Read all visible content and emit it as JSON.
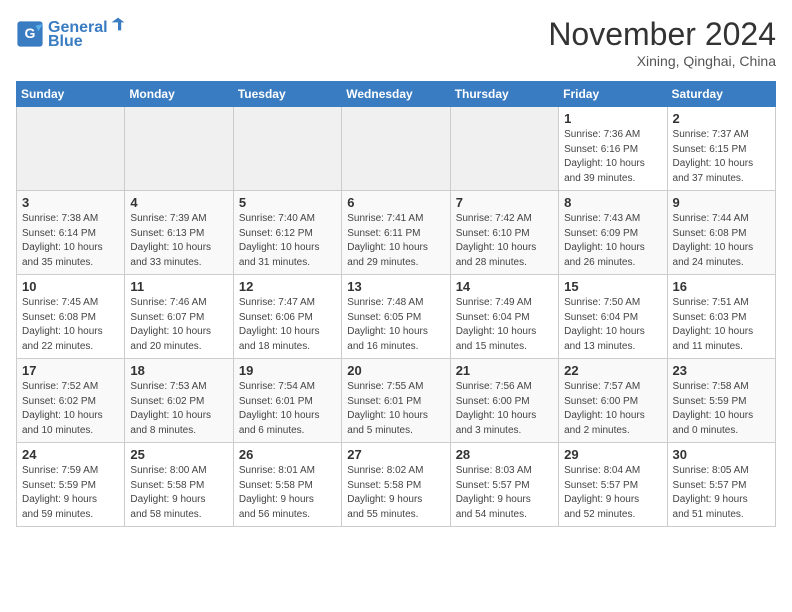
{
  "header": {
    "logo_line1": "General",
    "logo_line2": "Blue",
    "month": "November 2024",
    "location": "Xining, Qinghai, China"
  },
  "weekdays": [
    "Sunday",
    "Monday",
    "Tuesday",
    "Wednesday",
    "Thursday",
    "Friday",
    "Saturday"
  ],
  "weeks": [
    [
      {
        "day": "",
        "info": ""
      },
      {
        "day": "",
        "info": ""
      },
      {
        "day": "",
        "info": ""
      },
      {
        "day": "",
        "info": ""
      },
      {
        "day": "",
        "info": ""
      },
      {
        "day": "1",
        "info": "Sunrise: 7:36 AM\nSunset: 6:16 PM\nDaylight: 10 hours\nand 39 minutes."
      },
      {
        "day": "2",
        "info": "Sunrise: 7:37 AM\nSunset: 6:15 PM\nDaylight: 10 hours\nand 37 minutes."
      }
    ],
    [
      {
        "day": "3",
        "info": "Sunrise: 7:38 AM\nSunset: 6:14 PM\nDaylight: 10 hours\nand 35 minutes."
      },
      {
        "day": "4",
        "info": "Sunrise: 7:39 AM\nSunset: 6:13 PM\nDaylight: 10 hours\nand 33 minutes."
      },
      {
        "day": "5",
        "info": "Sunrise: 7:40 AM\nSunset: 6:12 PM\nDaylight: 10 hours\nand 31 minutes."
      },
      {
        "day": "6",
        "info": "Sunrise: 7:41 AM\nSunset: 6:11 PM\nDaylight: 10 hours\nand 29 minutes."
      },
      {
        "day": "7",
        "info": "Sunrise: 7:42 AM\nSunset: 6:10 PM\nDaylight: 10 hours\nand 28 minutes."
      },
      {
        "day": "8",
        "info": "Sunrise: 7:43 AM\nSunset: 6:09 PM\nDaylight: 10 hours\nand 26 minutes."
      },
      {
        "day": "9",
        "info": "Sunrise: 7:44 AM\nSunset: 6:08 PM\nDaylight: 10 hours\nand 24 minutes."
      }
    ],
    [
      {
        "day": "10",
        "info": "Sunrise: 7:45 AM\nSunset: 6:08 PM\nDaylight: 10 hours\nand 22 minutes."
      },
      {
        "day": "11",
        "info": "Sunrise: 7:46 AM\nSunset: 6:07 PM\nDaylight: 10 hours\nand 20 minutes."
      },
      {
        "day": "12",
        "info": "Sunrise: 7:47 AM\nSunset: 6:06 PM\nDaylight: 10 hours\nand 18 minutes."
      },
      {
        "day": "13",
        "info": "Sunrise: 7:48 AM\nSunset: 6:05 PM\nDaylight: 10 hours\nand 16 minutes."
      },
      {
        "day": "14",
        "info": "Sunrise: 7:49 AM\nSunset: 6:04 PM\nDaylight: 10 hours\nand 15 minutes."
      },
      {
        "day": "15",
        "info": "Sunrise: 7:50 AM\nSunset: 6:04 PM\nDaylight: 10 hours\nand 13 minutes."
      },
      {
        "day": "16",
        "info": "Sunrise: 7:51 AM\nSunset: 6:03 PM\nDaylight: 10 hours\nand 11 minutes."
      }
    ],
    [
      {
        "day": "17",
        "info": "Sunrise: 7:52 AM\nSunset: 6:02 PM\nDaylight: 10 hours\nand 10 minutes."
      },
      {
        "day": "18",
        "info": "Sunrise: 7:53 AM\nSunset: 6:02 PM\nDaylight: 10 hours\nand 8 minutes."
      },
      {
        "day": "19",
        "info": "Sunrise: 7:54 AM\nSunset: 6:01 PM\nDaylight: 10 hours\nand 6 minutes."
      },
      {
        "day": "20",
        "info": "Sunrise: 7:55 AM\nSunset: 6:01 PM\nDaylight: 10 hours\nand 5 minutes."
      },
      {
        "day": "21",
        "info": "Sunrise: 7:56 AM\nSunset: 6:00 PM\nDaylight: 10 hours\nand 3 minutes."
      },
      {
        "day": "22",
        "info": "Sunrise: 7:57 AM\nSunset: 6:00 PM\nDaylight: 10 hours\nand 2 minutes."
      },
      {
        "day": "23",
        "info": "Sunrise: 7:58 AM\nSunset: 5:59 PM\nDaylight: 10 hours\nand 0 minutes."
      }
    ],
    [
      {
        "day": "24",
        "info": "Sunrise: 7:59 AM\nSunset: 5:59 PM\nDaylight: 9 hours\nand 59 minutes."
      },
      {
        "day": "25",
        "info": "Sunrise: 8:00 AM\nSunset: 5:58 PM\nDaylight: 9 hours\nand 58 minutes."
      },
      {
        "day": "26",
        "info": "Sunrise: 8:01 AM\nSunset: 5:58 PM\nDaylight: 9 hours\nand 56 minutes."
      },
      {
        "day": "27",
        "info": "Sunrise: 8:02 AM\nSunset: 5:58 PM\nDaylight: 9 hours\nand 55 minutes."
      },
      {
        "day": "28",
        "info": "Sunrise: 8:03 AM\nSunset: 5:57 PM\nDaylight: 9 hours\nand 54 minutes."
      },
      {
        "day": "29",
        "info": "Sunrise: 8:04 AM\nSunset: 5:57 PM\nDaylight: 9 hours\nand 52 minutes."
      },
      {
        "day": "30",
        "info": "Sunrise: 8:05 AM\nSunset: 5:57 PM\nDaylight: 9 hours\nand 51 minutes."
      }
    ]
  ]
}
